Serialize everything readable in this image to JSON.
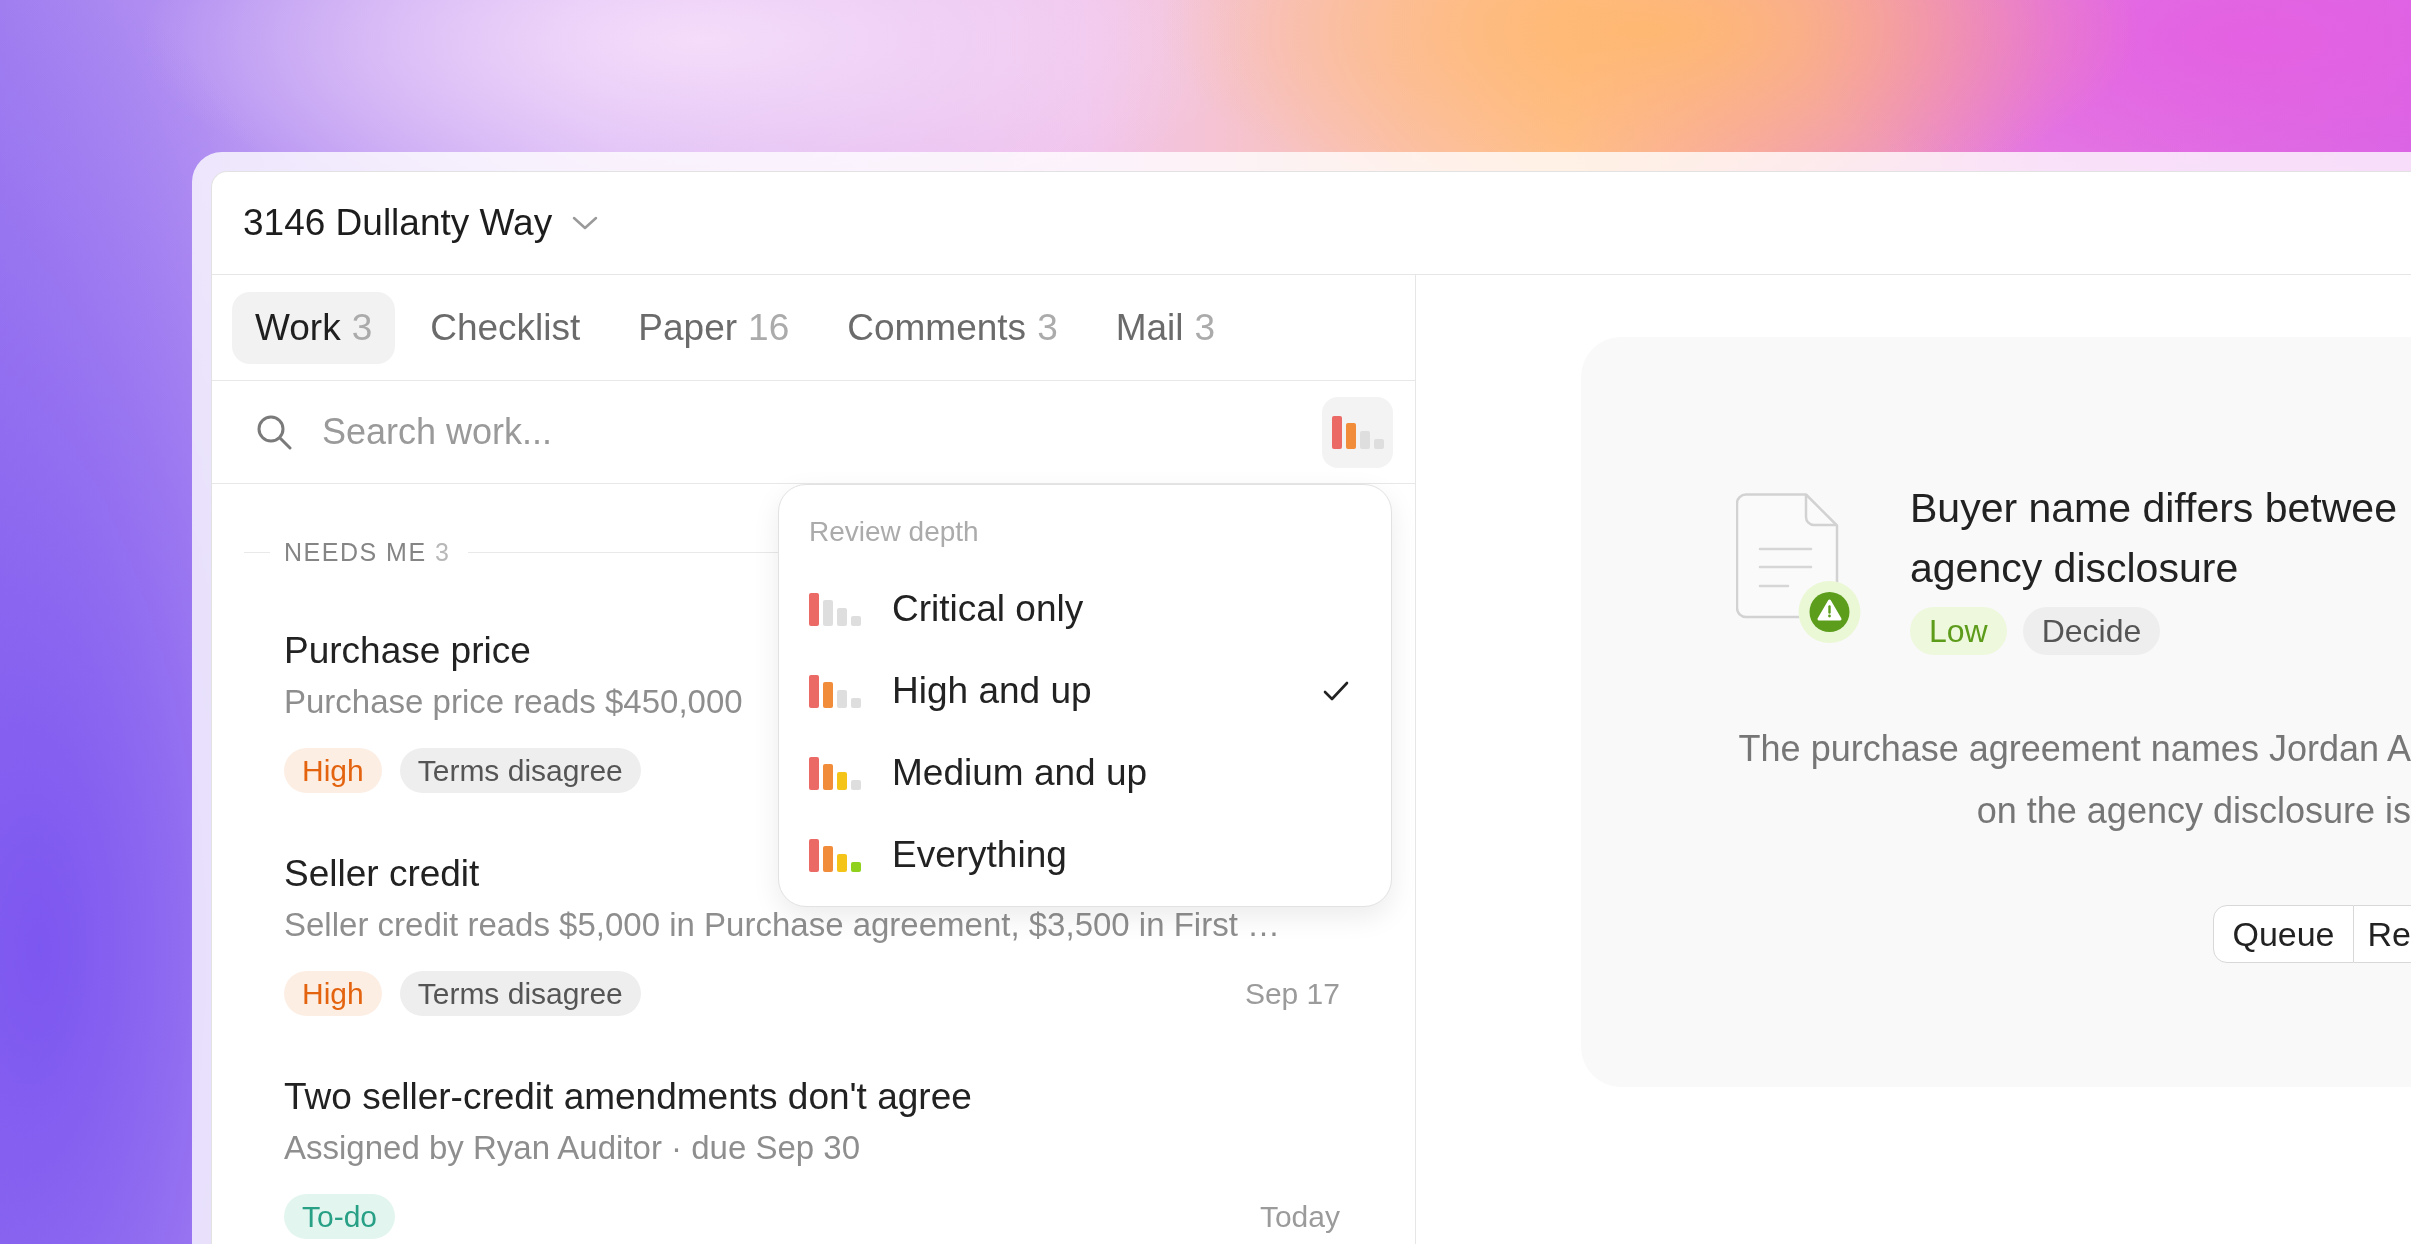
{
  "window": {
    "title": "3146 Dullanty Way"
  },
  "tabs": [
    {
      "label": "Work",
      "count": "3",
      "selected": true
    },
    {
      "label": "Checklist",
      "selected": false
    },
    {
      "label": "Paper",
      "count": "16",
      "selected": false
    },
    {
      "label": "Comments",
      "count": "3",
      "selected": false
    },
    {
      "label": "Mail",
      "count": "3",
      "selected": false
    }
  ],
  "search": {
    "placeholder": "Search work..."
  },
  "filter_button": {
    "kind": "high"
  },
  "section": {
    "label": "NEEDS ME",
    "count": "3"
  },
  "items": [
    {
      "title": "Purchase price",
      "description": "Purchase price reads $450,000",
      "tags": [
        {
          "label": "High",
          "kind": "high"
        },
        {
          "label": "Terms disagree",
          "kind": "category"
        }
      ]
    },
    {
      "title": "Seller credit",
      "description": "Seller credit reads $5,000 in Purchase agreement, $3,500 in First …",
      "tags": [
        {
          "label": "High",
          "kind": "high"
        },
        {
          "label": "Terms disagree",
          "kind": "category"
        }
      ],
      "date": "Sep 17"
    },
    {
      "title": "Two seller-credit amendments don't agree",
      "description": "Assigned by Ryan Auditor · due Sep 30",
      "tags": [
        {
          "label": "To-do",
          "kind": "todo"
        }
      ],
      "date": "Today"
    }
  ],
  "review_menu": {
    "heading": "Review depth",
    "options": [
      {
        "label": "Critical only",
        "kind": "critical",
        "selected": false
      },
      {
        "label": "High and up",
        "kind": "high",
        "selected": true
      },
      {
        "label": "Medium and up",
        "kind": "medium",
        "selected": false
      },
      {
        "label": "Everything",
        "kind": "all",
        "selected": false
      }
    ]
  },
  "detail": {
    "title_lines": [
      "Buyer name differs betwee",
      "agency disclosure"
    ],
    "tags": [
      {
        "label": "Low",
        "kind": "low"
      },
      {
        "label": "Decide",
        "kind": "action"
      }
    ],
    "body_lines": [
      "The purchase agreement names Jordan A",
      "on the agency disclosure is"
    ],
    "buttons": [
      "Queue",
      "Re"
    ]
  }
}
